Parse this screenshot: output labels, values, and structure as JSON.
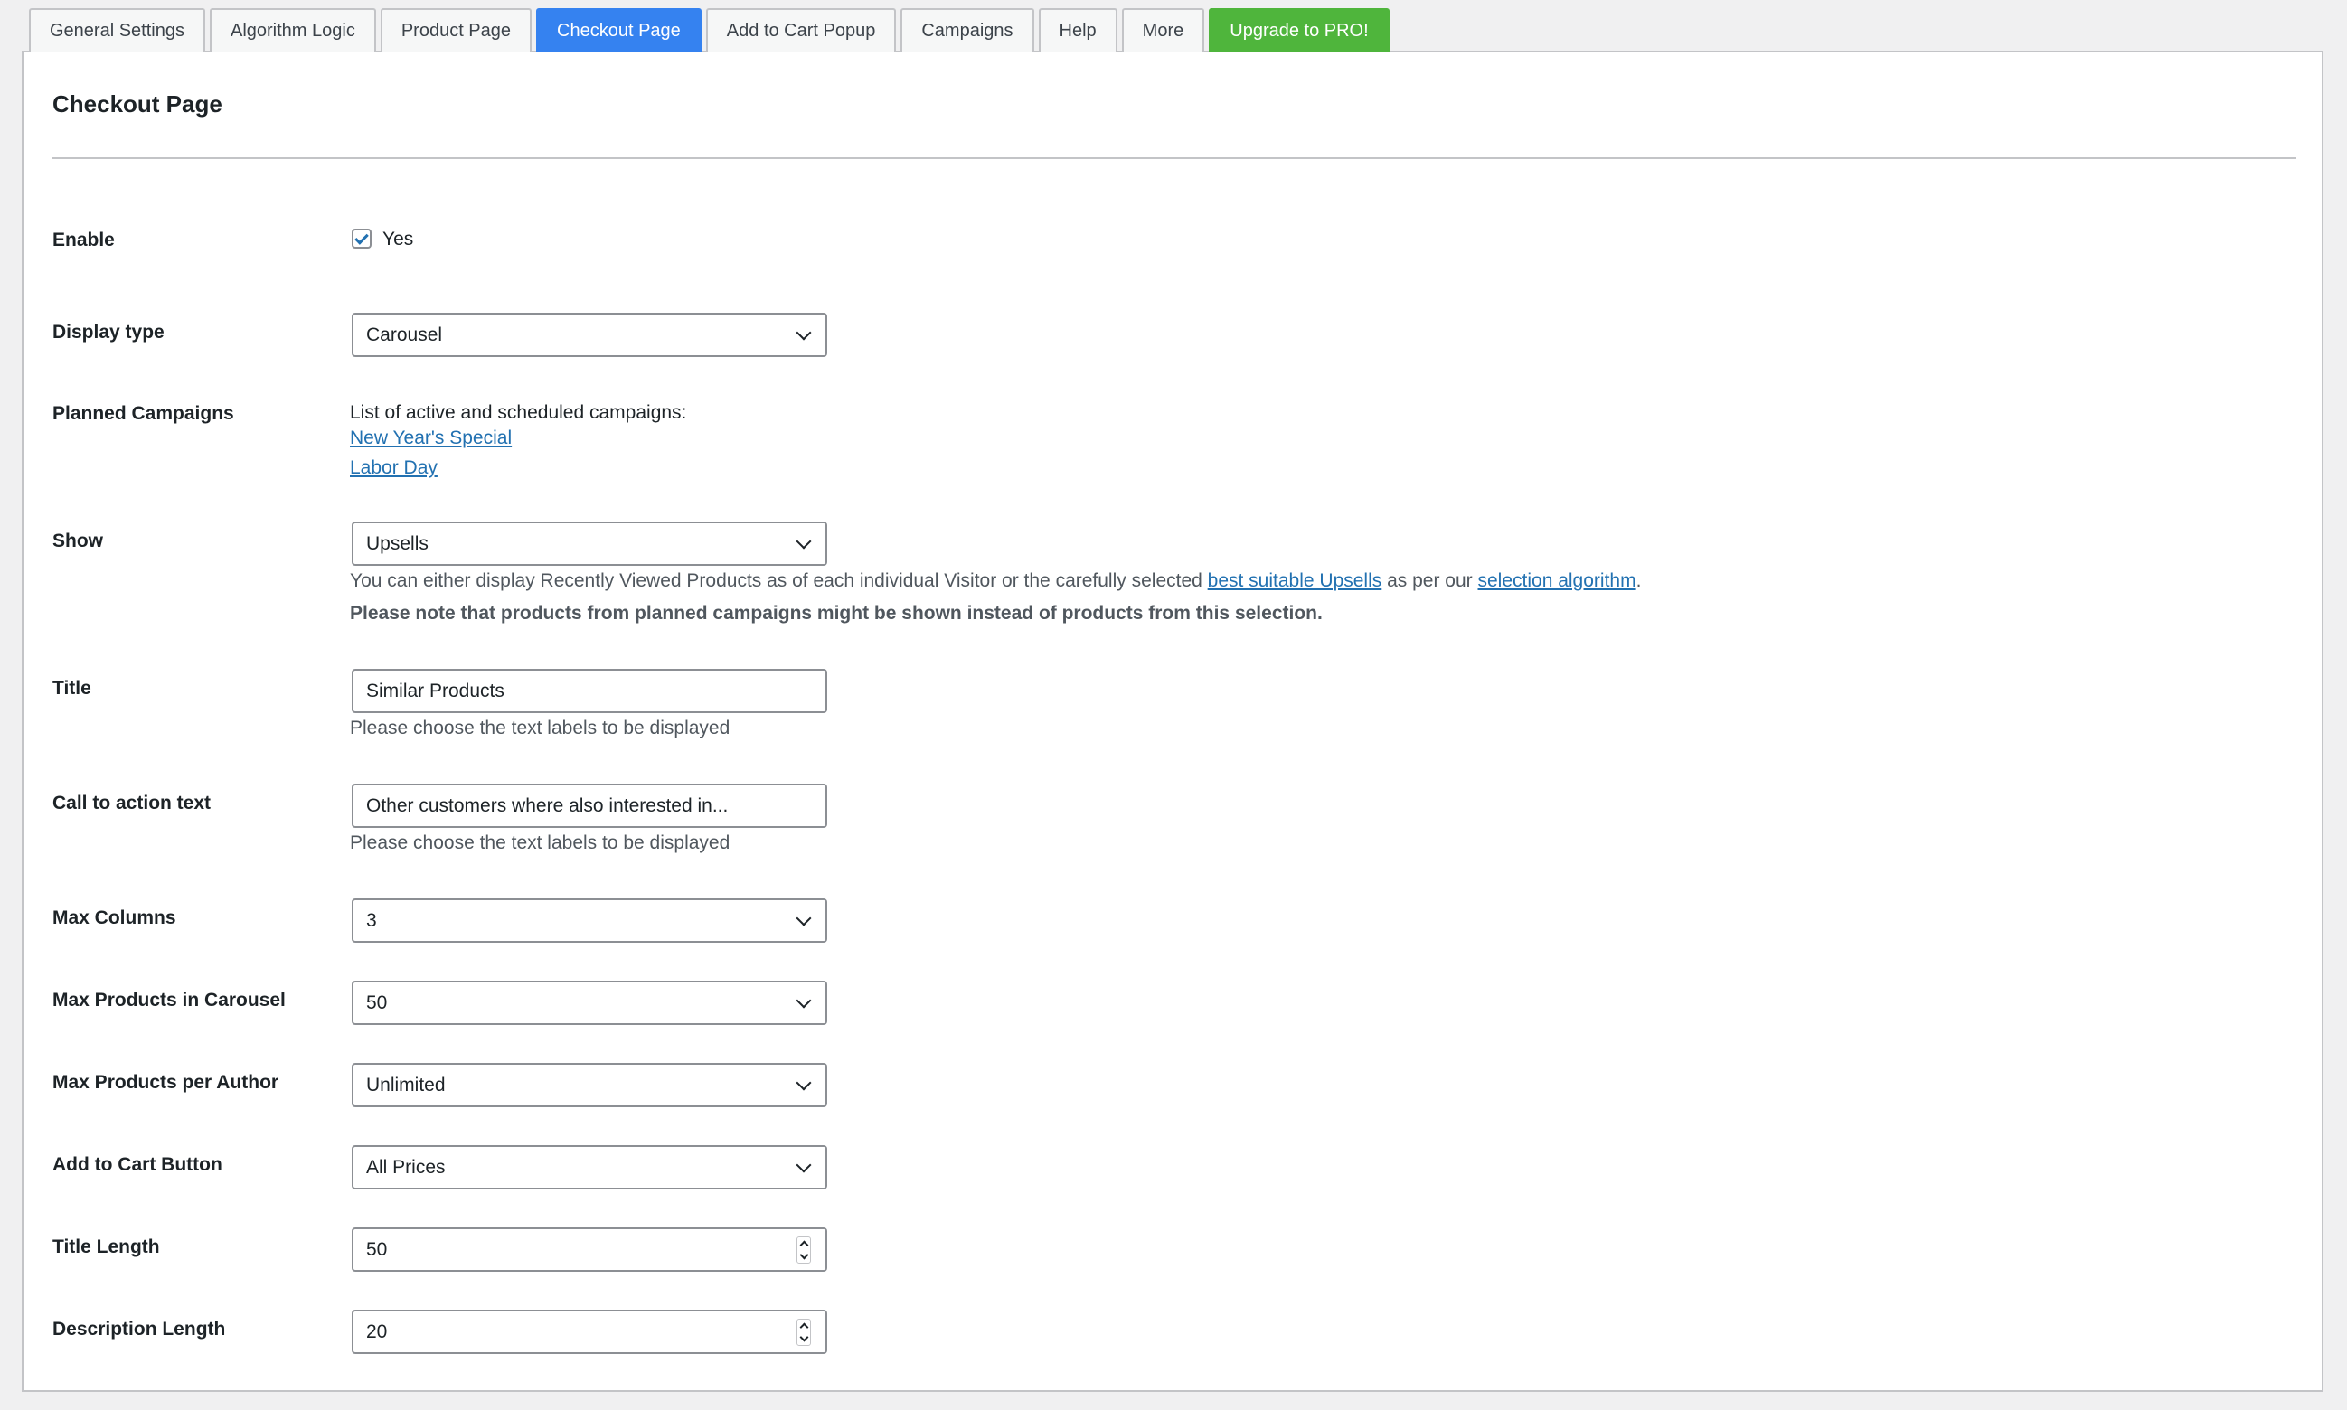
{
  "tabs": [
    {
      "label": "General Settings"
    },
    {
      "label": "Algorithm Logic"
    },
    {
      "label": "Product Page"
    },
    {
      "label": "Checkout Page"
    },
    {
      "label": "Add to Cart Popup"
    },
    {
      "label": "Campaigns"
    },
    {
      "label": "Help"
    },
    {
      "label": "More"
    },
    {
      "label": "Upgrade to PRO!"
    }
  ],
  "active_tab": "Checkout Page",
  "colors": {
    "active_tab": "#3582f0",
    "pro_tab": "#4fb53c",
    "link": "#2271b1"
  },
  "page": {
    "title": "Checkout Page"
  },
  "fields": {
    "enable": {
      "label": "Enable",
      "checked": true,
      "option_label": "Yes"
    },
    "display_type": {
      "label": "Display type",
      "value": "Carousel"
    },
    "planned_campaigns": {
      "label": "Planned Campaigns",
      "intro": "List of active and scheduled campaigns:",
      "campaigns": [
        "New Year's Special",
        "Labor Day"
      ]
    },
    "show": {
      "label": "Show",
      "value": "Upsells",
      "desc_part1": "You can either display Recently Viewed Products as of each individual Visitor or the carefully selected ",
      "desc_link1": "best suitable Upsells",
      "desc_part2": " as per our ",
      "desc_link2": "selection algorithm",
      "desc_part3": ".",
      "note": "Please note that products from planned campaigns might be shown instead of products from this selection."
    },
    "title": {
      "label": "Title",
      "value": "Similar Products",
      "desc": "Please choose the text labels to be displayed"
    },
    "cta": {
      "label": "Call to action text",
      "value": "Other customers where also interested in...",
      "desc": "Please choose the text labels to be displayed"
    },
    "max_columns": {
      "label": "Max Columns",
      "value": "3"
    },
    "max_products_carousel": {
      "label": "Max Products in Carousel",
      "value": "50"
    },
    "max_products_author": {
      "label": "Max Products per Author",
      "value": "Unlimited"
    },
    "add_to_cart": {
      "label": "Add to Cart Button",
      "value": "All Prices"
    },
    "title_length": {
      "label": "Title Length",
      "value": "50"
    },
    "description_length": {
      "label": "Description Length",
      "value": "20"
    }
  }
}
